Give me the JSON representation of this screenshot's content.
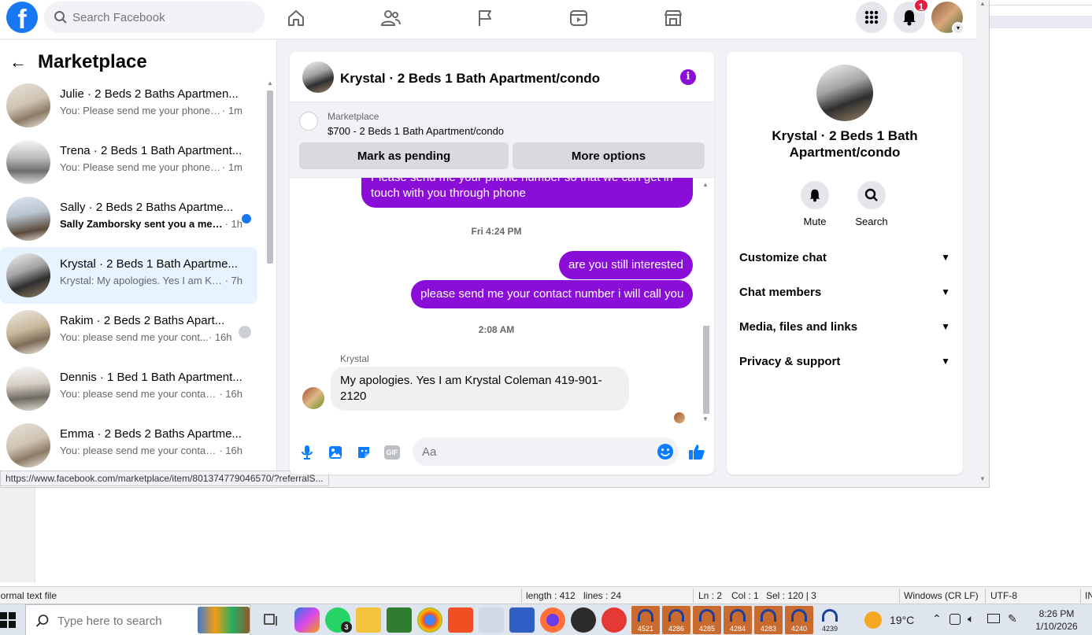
{
  "browser": {
    "search_placeholder": "Search Facebook",
    "notification_count": "1",
    "url_tooltip": "https://www.facebook.com/marketplace/item/801374779046570/?referralS..."
  },
  "sidebar": {
    "title": "Marketplace",
    "conversations": [
      {
        "title": "Julie · 2 Beds 2 Baths Apartmen...",
        "snippet": "You: Please send me your phone n...",
        "time": " · 1m",
        "unread": false
      },
      {
        "title": "Trena · 2 Beds 1 Bath Apartment...",
        "snippet": "You: Please send me your phone n...",
        "time": " · 1m",
        "unread": false
      },
      {
        "title": "Sally · 2 Beds 2 Baths Apartme...",
        "snippet": "Sally Zamborsky sent you a mes...",
        "time": " · 1h",
        "unread": true
      },
      {
        "title": "Krystal · 2 Beds 1 Bath Apartme...",
        "snippet": "Krystal: My apologies. Yes I am Kry...",
        "time": " · 7h",
        "unread": false
      },
      {
        "title": "Rakim · 2 Beds 2 Baths Apart...",
        "snippet": "You: please send me your cont...",
        "time": " · 16h",
        "unread": false
      },
      {
        "title": "Dennis · 1 Bed 1 Bath Apartment...",
        "snippet": "You: please send me your contact...",
        "time": " · 16h",
        "unread": false
      },
      {
        "title": "Emma · 2 Beds 2 Baths Apartme...",
        "snippet": "You: please send me your contact...",
        "time": " · 16h",
        "unread": false
      }
    ]
  },
  "chat": {
    "title": "Krystal · 2 Beds 1 Bath Apartment/condo",
    "listing_label": "Marketplace",
    "listing_price": "$700 - 2 Beds 1 Bath Apartment/condo",
    "mark_pending_label": "Mark as pending",
    "more_options_label": "More options",
    "msg_partial": "Please send me your phone  number so that we can get in touch with you through phone",
    "ts1": "Fri 4:24 PM",
    "msg_interested": "are you still interested",
    "msg_contact": "please send me your contact number i will call you",
    "ts2": "2:08 AM",
    "sender": "Krystal",
    "msg_reply": "My apologies. Yes I am Krystal Coleman 419-901-2120",
    "composer_placeholder": "Aa",
    "gif_label": "GIF"
  },
  "info_panel": {
    "name": "Krystal · 2 Beds 1 Bath Apartment/condo",
    "mute_label": "Mute",
    "search_label": "Search",
    "rows": [
      "Customize chat",
      "Chat members",
      "Media, files and links",
      "Privacy & support"
    ]
  },
  "statusbar": {
    "filetype": "Normal text file",
    "length": "length : 412",
    "lines": "lines : 24",
    "ln": "Ln : 2",
    "col": "Col : 1",
    "sel": "Sel : 120 | 3",
    "eol": "Windows (CR LF)",
    "encoding": "UTF-8",
    "ins": "INS"
  },
  "taskbar": {
    "search_placeholder": "Type here to search",
    "whatsapp_badge": "3",
    "tickets": [
      "4521",
      "4286",
      "4285",
      "4284",
      "4283",
      "4240",
      "4239"
    ],
    "temperature": "19°C",
    "time": "8:26 PM",
    "date": "1/10/2026"
  }
}
